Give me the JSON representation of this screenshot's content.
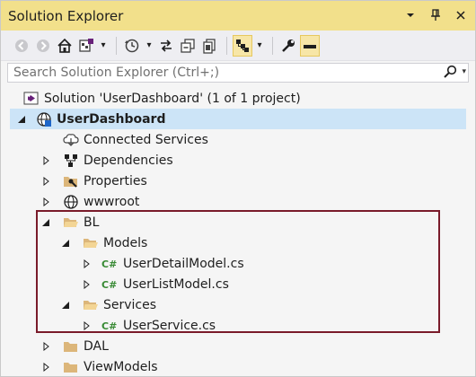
{
  "window": {
    "title": "Solution Explorer",
    "title_controls": [
      "chevron-down-icon",
      "pin-icon",
      "close-icon"
    ]
  },
  "toolbar": {
    "buttons": [
      "back-icon",
      "forward-icon",
      "home-icon",
      "switch-views-icon",
      "pending-changes-icon",
      "sync-icon",
      "collapse-all-icon",
      "show-all-files-icon",
      "view-class-diagram-icon",
      "properties-icon",
      "preview-icon"
    ]
  },
  "search": {
    "placeholder": "Search Solution Explorer (Ctrl+;)"
  },
  "tree": {
    "solution": "Solution 'UserDashboard' (1 of 1 project)",
    "project": "UserDashboard",
    "connected_services": "Connected Services",
    "dependencies": "Dependencies",
    "properties": "Properties",
    "wwwroot": "wwwroot",
    "bl": "BL",
    "models": "Models",
    "user_detail_model": "UserDetailModel.cs",
    "user_list_model": "UserListModel.cs",
    "services": "Services",
    "user_service": "UserService.cs",
    "dal": "DAL",
    "view_models": "ViewModels"
  },
  "colors": {
    "title_bar": "#f2e08b",
    "selection": "#cce4f7",
    "highlight_border": "#7a1b2a",
    "folder": "#dcb67a",
    "csharp": "#388a34"
  }
}
